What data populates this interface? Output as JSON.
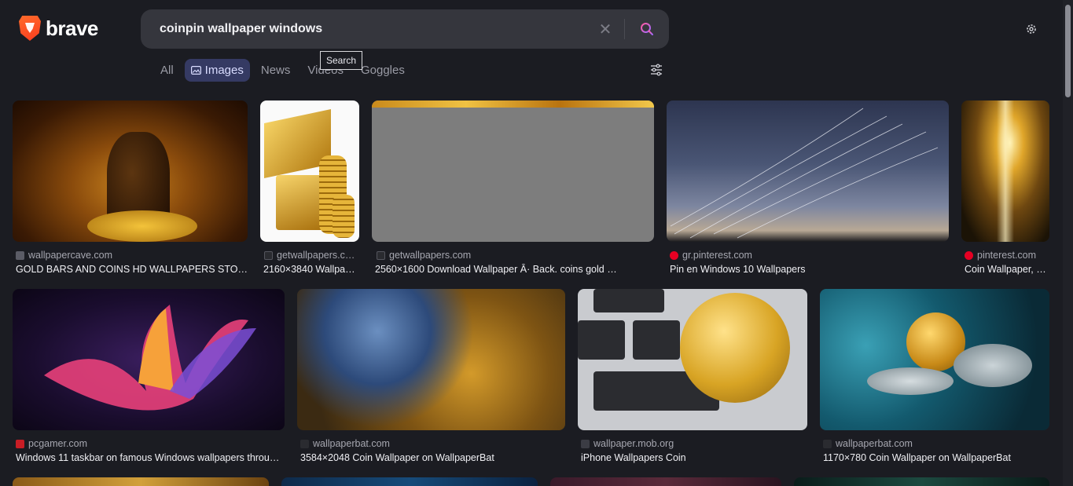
{
  "brand": {
    "name": "brave"
  },
  "search": {
    "query": "coinpin wallpaper windows",
    "tooltip": "Search"
  },
  "tabs": [
    {
      "label": "All"
    },
    {
      "label": "Images"
    },
    {
      "label": "News"
    },
    {
      "label": "Videos"
    },
    {
      "label": "Goggles"
    }
  ],
  "results": [
    {
      "source": "wallpapercave.com",
      "title": "GOLD BARS AND COINS HD WALLPAPERS STOC…",
      "favicon_color": "#5b5c66"
    },
    {
      "source": "getwallpapers.c…",
      "title": "2160×3840 Wallpa…",
      "favicon_color": "#2a2b30"
    },
    {
      "source": "getwallpapers.com",
      "title": "2560×1600 Download Wallpaper Â· Back. coins gold …",
      "favicon_color": "#2a2b30"
    },
    {
      "source": "gr.pinterest.com",
      "title": "Pin en Windows 10 Wallpapers",
      "favicon_color": "#e60023"
    },
    {
      "source": "pinterest.com",
      "title": "Coin Wallpaper, …",
      "favicon_color": "#e60023"
    },
    {
      "source": "pcgamer.com",
      "title": "Windows 11 taskbar on famous Windows wallpapers throu…",
      "favicon_color": "#c81d25"
    },
    {
      "source": "wallpaperbat.com",
      "title": "3584×2048 Coin Wallpaper on WallpaperBat",
      "favicon_color": "#2a2b30"
    },
    {
      "source": "wallpaper.mob.org",
      "title": "iPhone Wallpapers Coin",
      "favicon_color": "#3b3c44"
    },
    {
      "source": "wallpaperbat.com",
      "title": "1170×780 Coin Wallpaper on WallpaperBat",
      "favicon_color": "#2a2b30"
    }
  ]
}
